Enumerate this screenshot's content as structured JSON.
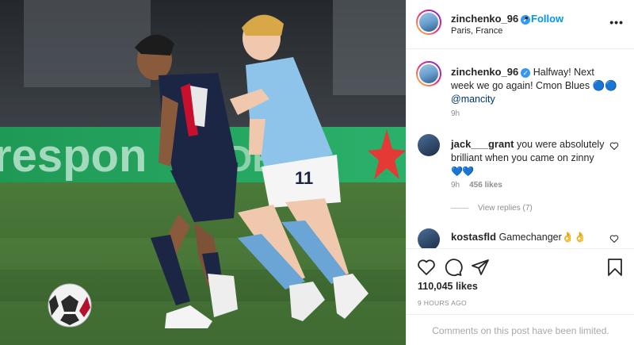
{
  "post": {
    "author": "zinchenko_96",
    "location": "Paris, France",
    "follow_label": "Follow",
    "dot": "•",
    "more_label": "•••",
    "caption": {
      "username": "zinchenko_96",
      "text": "Halfway! Next week we go again! Cmon Blues",
      "emoji": "🔵🔵",
      "mention": "@mancity",
      "time": "9h"
    },
    "verified_glyph": "✓",
    "comments": [
      {
        "username": "jack___grant",
        "text": "you were absolutely brilliant when you came on zinny",
        "emoji": "💙💙",
        "time": "9h",
        "likes": "456 likes",
        "view_replies": "View replies (7)"
      },
      {
        "username": "kostasfld",
        "text": "Gamechanger",
        "emoji": "👌👌"
      }
    ],
    "likes": "110,045 likes",
    "posted_ago": "9 HOURS AGO",
    "comments_limited": "Comments on this post have been limited."
  },
  "photo": {
    "banner_text": "respon",
    "banner_text_right": "DE",
    "shirt_number": "11"
  },
  "colors": {
    "accent_blue": "#0095f6",
    "verified": "#3897f0",
    "city_blue": "#8ec4ea",
    "psg_navy": "#1b2544",
    "pitch_green": "#3d6b2f"
  },
  "icons": [
    "heart-icon",
    "comment-icon",
    "share-icon",
    "bookmark-icon",
    "more-options-icon",
    "verified-icon",
    "heart-outline-icon"
  ]
}
